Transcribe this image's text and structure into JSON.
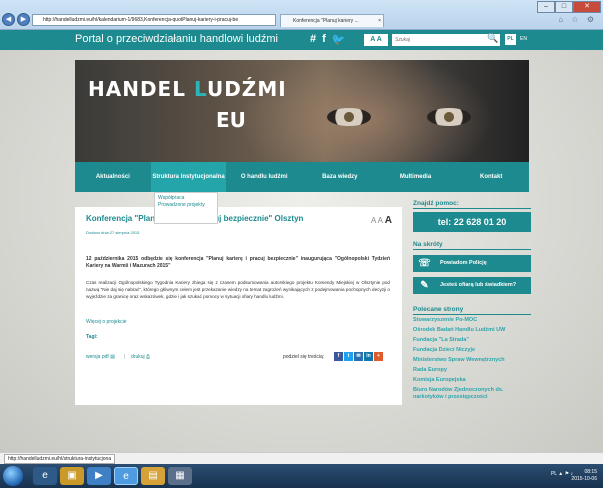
{
  "browser": {
    "address": "http://handelludzmi.eu/hl/kalendarium-1/9683,Konferencja-quotPlanuj-kariery-i-pracuj-be",
    "tab_label": "Konferencja \"Planuj kariery ...",
    "tab_close": "×",
    "nav_back": "◀",
    "nav_forward": "▶",
    "search_icon": "⌕",
    "refresh_icon": "↻",
    "min": "–",
    "max": "□",
    "close": "✕",
    "toolbar_icons": "⌂ ☆ ⚙"
  },
  "topbar": {
    "portal_title": "Portal o przeciwdziałaniu handlowi ludźmi",
    "icons": [
      "#",
      "f",
      "🐦"
    ],
    "aa_label": "A A",
    "search_placeholder": "Szukaj",
    "search_icon": "🔍",
    "lang_pl": "PL",
    "lang_en": "EN"
  },
  "banner": {
    "logo_part1": "HANDEL ",
    "logo_accent": "L",
    "logo_part2": "UDŹMI",
    "logo_eu": "EU"
  },
  "nav": {
    "items": [
      "Aktualności",
      "Struktura instytucjonalna",
      "O handlu ludźmi",
      "Baza wiedzy",
      "Multimedia",
      "Kontakt"
    ]
  },
  "dropdown": {
    "items": [
      "Współpraca",
      "Prowadzone projekty"
    ]
  },
  "article": {
    "title": "Konferencja \"Planuj karierę i pracuj bezpiecznie\" Olsztyn",
    "font_size_small": "A",
    "font_size_mid": "A",
    "font_size_large": "A",
    "date": "Dodano dnia 27 sierpnia 2015",
    "lead": "12 października 2015 odbędzie się konferencja \"Planuj karierę i pracuj bezpiecznie\" inaugurująca \"Ogólnopolski Tydzień Kariery na Warmii i Mazurach 2015\"",
    "body": "Czas realizacji Ogólnopolskiego Tygodnia Kariery zbiega się z czasem podsumowania autorskiego projektu Komendy Miejskiej w Olsztynie pod nazwą \"Nie daj się nabrać\", którego głównym celem jest przekazanie wiedzy na temat zagrożeń wynikających z podejmowania pochopnych decyzji o wyjeździe za granicę oraz wskazówek, gdzie i jak szukać pomocy w sytuacji ofiary handlu ludźmi.",
    "more": "Więcej o projekcie",
    "tags": "Tagi:",
    "pdf": "wersja pdf",
    "separator": "|",
    "print": "drukuj",
    "share_label": "podziel się treścią:",
    "share_icons": [
      "f",
      "t",
      "✉",
      "in",
      "+"
    ]
  },
  "sidebar": {
    "help_heading": "Znajdź pomoc:",
    "phone": "tel: 22 628 01 20",
    "shortcuts_heading": "Na skróty",
    "notify_police": "Powiadom Policję",
    "victim_question": "Jesteś ofiarą lub świadkiem?",
    "recommended_heading": "Polecane strony",
    "links": [
      "Stowarzyszenie Po-MOC",
      "Ośrodek Badań Handlu Ludźmi UW",
      "Fundacja \"La Strada\"",
      "Fundacja Dzieci Niczyje",
      "Ministerstwo Spraw Wewnętrznych",
      "Rada Europy",
      "Komisja Europejska",
      "Biuro Narodów Zjednoczonych ds. narkotyków i przestępczości"
    ]
  },
  "statusbar": {
    "url": "http://handelludzmi.eu/hl/struktura-instytucjona"
  },
  "taskbar": {
    "time": "08:15",
    "date": "2015-10-06",
    "tray_lang": "PL"
  }
}
